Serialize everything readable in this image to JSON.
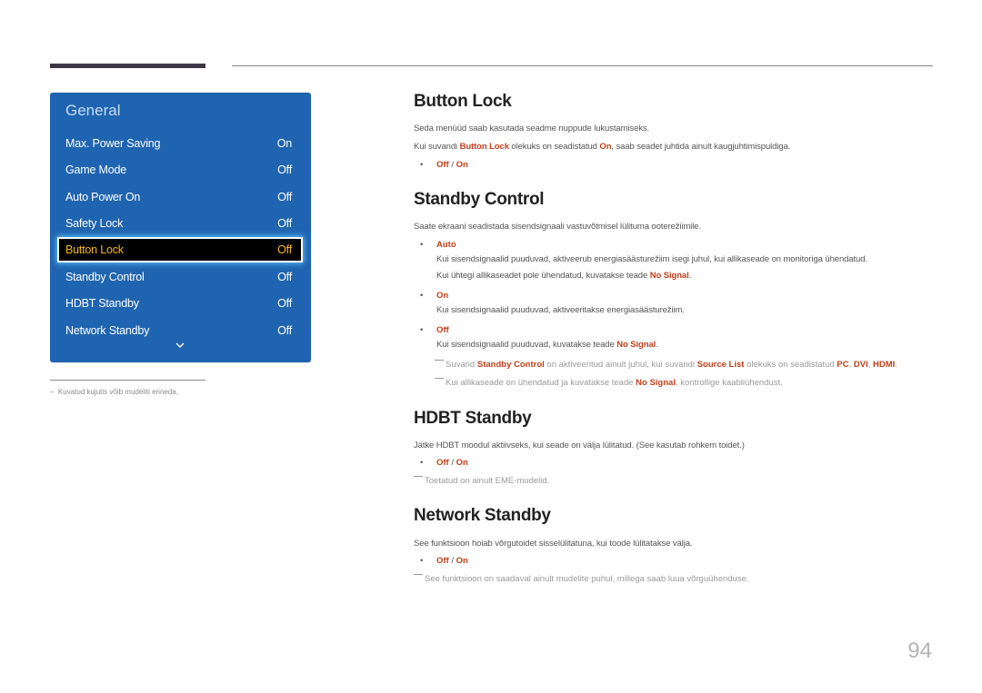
{
  "menu": {
    "title": "General",
    "items": [
      {
        "label": "Max. Power Saving",
        "value": "On"
      },
      {
        "label": "Game Mode",
        "value": "Off"
      },
      {
        "label": "Auto Power On",
        "value": "Off"
      },
      {
        "label": "Safety Lock",
        "value": "Off"
      },
      {
        "label": "Button Lock",
        "value": "Off",
        "selected": true
      },
      {
        "label": "Standby Control",
        "value": "Off"
      },
      {
        "label": "HDBT Standby",
        "value": "Off"
      },
      {
        "label": "Network Standby",
        "value": "Off"
      }
    ],
    "more_icon": "chevron-down-icon"
  },
  "footnote": "Kuvatud kujutis võib mudeliti erineda.",
  "colors": {
    "menu_bg": "#1f64b0",
    "highlight": "#c1401b",
    "selected_text": "#f3b61c"
  },
  "sections": {
    "button_lock": {
      "title": "Button Lock",
      "p1": "Seda menüüd saab kasutada seadme nuppude lukustamiseks.",
      "p2_a": "Kui suvandi ",
      "p2_b": "Button Lock",
      "p2_c": " olekuks on seadistatud ",
      "p2_d": "On",
      "p2_e": ", saab seadet juhtida ainult kaugjuhtimispuldiga.",
      "opt_off": "Off",
      "opt_sep": " / ",
      "opt_on": "On"
    },
    "standby_control": {
      "title": "Standby Control",
      "p1": "Saate ekraani seadistada sisendsignaali vastuvõtmisel lülituma ooterežiimile.",
      "auto_label": "Auto",
      "auto_d1": "Kui sisendsignaalid puuduvad, aktiveerub energiasäästurežiim isegi juhul, kui allikaseade on monitoriga ühendatud.",
      "auto_d2_a": "Kui ühtegi allikaseadet pole ühendatud, kuvatakse teade ",
      "auto_d2_b": "No Signal",
      "auto_d2_c": ".",
      "on_label": "On",
      "on_d1": "Kui sisendsignaalid puuduvad, aktiveeritakse energiasäästurežiim.",
      "off_label": "Off",
      "off_d1_a": "Kui sisendsignaalid puuduvad, kuvatakse teade ",
      "off_d1_b": "No Signal",
      "off_d1_c": ".",
      "note1_a": "Suvand ",
      "note1_b": "Standby Control",
      "note1_c": " on aktiveeritud ainult juhul, kui suvandi ",
      "note1_d": "Source List",
      "note1_e": " olekuks on seadistatud ",
      "note1_f": "PC",
      "note1_g": ", ",
      "note1_h": "DVI",
      "note1_i": ", ",
      "note1_j": "HDMI",
      "note1_k": ".",
      "note2_a": "Kui allikaseade on ühendatud ja kuvatakse teade ",
      "note2_b": "No Signal",
      "note2_c": ", kontrollige kaabliühendust."
    },
    "hdbt_standby": {
      "title": "HDBT Standby",
      "p1": "Jätke HDBT moodul aktiivseks, kui seade on välja lülitatud. (See kasutab rohkem toidet.)",
      "opt_off": "Off",
      "opt_sep": " / ",
      "opt_on": "On",
      "note1": "Toetatud on ainult EME-mudelid."
    },
    "network_standby": {
      "title": "Network Standby",
      "p1": "See funktsioon hoiab võrgutoidet sisselülitatuna, kui toode lülitatakse välja.",
      "opt_off": "Off",
      "opt_sep": " / ",
      "opt_on": "On",
      "note1": "See funktsioon on saadaval ainult mudelite puhul, millega saab luua võrguühenduse."
    }
  },
  "bullet": "•",
  "page_number": "94"
}
